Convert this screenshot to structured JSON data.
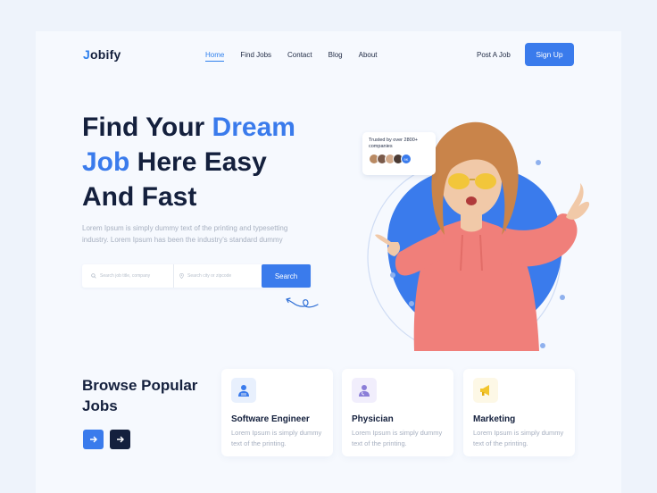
{
  "brand": {
    "logo_initial": "J",
    "logo_rest": "obify"
  },
  "nav": {
    "items": [
      {
        "label": "Home",
        "active": true
      },
      {
        "label": "Find Jobs",
        "active": false
      },
      {
        "label": "Contact",
        "active": false
      },
      {
        "label": "Blog",
        "active": false
      },
      {
        "label": "About",
        "active": false
      }
    ],
    "post_job": "Post A Job",
    "signup": "Sign Up"
  },
  "hero": {
    "title_part1": "Find Your ",
    "title_highlight1": "Dream",
    "title_highlight2": "Job",
    "title_part2": " Here Easy",
    "title_part3": "And Fast",
    "description": "Lorem Ipsum is simply dummy text of the printing and typesetting industry. Lorem Ipsum has been the industry's standard dummy",
    "search_job_placeholder": "Search job title, company",
    "search_location_placeholder": "Search city or zipcode",
    "search_button": "Search",
    "trusted_text": "Trusted by over 2800+ companies",
    "trusted_badge": "9K"
  },
  "browse": {
    "title_line1": "Browse Popular",
    "title_line2": "Jobs",
    "cards": [
      {
        "title": "Software Engineer",
        "description": "Lorem Ipsum is simply dummy text of the printing.",
        "icon": "software-engineer-icon",
        "icon_bg": "#e8f0fd"
      },
      {
        "title": "Physician",
        "description": "Lorem Ipsum is simply dummy text of the printing.",
        "icon": "physician-icon",
        "icon_bg": "#f1eefc"
      },
      {
        "title": "Marketing",
        "description": "Lorem Ipsum is simply dummy text of the printing.",
        "icon": "megaphone-icon",
        "icon_bg": "#fdf8e6"
      }
    ]
  },
  "colors": {
    "primary": "#3a7bec",
    "dark": "#14203d",
    "muted": "#a7b0c0",
    "hoodie": "#f07f7a"
  }
}
